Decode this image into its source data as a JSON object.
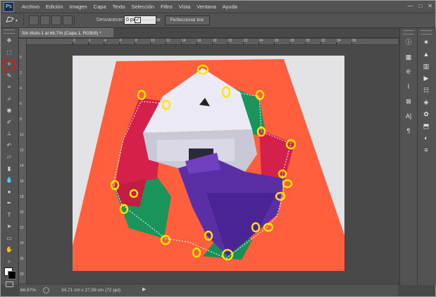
{
  "app": {
    "logo": "Ps"
  },
  "menu": [
    "Archivo",
    "Edición",
    "Imagen",
    "Capa",
    "Texto",
    "Selección",
    "Filtro",
    "Vista",
    "Ventana",
    "Ayuda"
  ],
  "window_controls": {
    "minimize": "—",
    "maximize": "□",
    "close": "✕"
  },
  "options": {
    "feather_label": "Desvanecer:",
    "feather_value": "0 px",
    "smooth_checked": "✓",
    "smooth_label": "Suavizar",
    "refine_label": "Perfeccionar bor."
  },
  "document": {
    "tab_title": "Sin título-1 al 66,7% (Capa 1, RGB/8) *"
  },
  "status": {
    "zoom": "66,67%",
    "doc_info": "34,71 cm x 27,59 cm (72 ppi)",
    "arrow": "▶"
  },
  "ruler_top_labels": [
    "0",
    "2",
    "4",
    "6",
    "8",
    "10",
    "12",
    "14",
    "16",
    "18",
    "20",
    "22",
    "24",
    "26",
    "28",
    "30",
    "32",
    "34",
    "36"
  ],
  "ruler_left_labels": [
    "0",
    "2",
    "4",
    "6",
    "8",
    "10",
    "12",
    "14",
    "16",
    "18",
    "20",
    "22",
    "24",
    "26",
    "28"
  ],
  "tools": [
    {
      "name": "move-tool",
      "glyph": "✥"
    },
    {
      "name": "marquee-tool",
      "glyph": "⬚"
    },
    {
      "name": "polygonal-lasso-tool",
      "glyph": "⟡"
    },
    {
      "name": "quick-selection-tool",
      "glyph": "✎"
    },
    {
      "name": "crop-tool",
      "glyph": "⌗"
    },
    {
      "name": "eyedropper-tool",
      "glyph": "⌿"
    },
    {
      "name": "spot-healing-tool",
      "glyph": "◉"
    },
    {
      "name": "brush-tool",
      "glyph": "✐"
    },
    {
      "name": "clone-stamp-tool",
      "glyph": "⊥"
    },
    {
      "name": "history-brush-tool",
      "glyph": "↶"
    },
    {
      "name": "eraser-tool",
      "glyph": "▱"
    },
    {
      "name": "gradient-tool",
      "glyph": "▮"
    },
    {
      "name": "blur-tool",
      "glyph": "💧"
    },
    {
      "name": "dodge-tool",
      "glyph": "●"
    },
    {
      "name": "pen-tool",
      "glyph": "✒"
    },
    {
      "name": "type-tool",
      "glyph": "T"
    },
    {
      "name": "path-selection-tool",
      "glyph": "➤"
    },
    {
      "name": "shape-tool",
      "glyph": "▭"
    },
    {
      "name": "hand-tool",
      "glyph": "✋"
    },
    {
      "name": "zoom-tool",
      "glyph": "⌕"
    }
  ],
  "right_panel_a": [
    {
      "name": "info-icon",
      "glyph": "ⓘ"
    },
    {
      "name": "navigator-icon",
      "glyph": "▦"
    },
    {
      "name": "adjust-icon",
      "glyph": "⚟"
    },
    {
      "name": "brush-preset-icon",
      "glyph": "⌇"
    },
    {
      "name": "clone-source-icon",
      "glyph": "⊠"
    },
    {
      "name": "character-icon",
      "glyph": "A|"
    },
    {
      "name": "paragraph-icon",
      "glyph": "¶"
    }
  ],
  "right_panel_b": [
    {
      "name": "color-icon",
      "glyph": "✷"
    },
    {
      "name": "histogram-icon",
      "glyph": "▲"
    },
    {
      "name": "swatches-icon",
      "glyph": "▥"
    },
    {
      "name": "actions-icon",
      "glyph": "▶"
    },
    {
      "name": "properties-icon",
      "glyph": "☷"
    },
    {
      "name": "layers-icon",
      "glyph": "◈"
    },
    {
      "name": "channels-icon",
      "glyph": "✿"
    },
    {
      "name": "paths-icon",
      "glyph": "⬒"
    },
    {
      "name": "styles-icon",
      "glyph": "◐"
    },
    {
      "name": "sliders-icon",
      "glyph": "≡"
    }
  ],
  "colors": {
    "background_paper": "#ff5f3c",
    "cube_white": "#ebeaf4",
    "cube_purple": "#5a2fa6",
    "panel_red": "#d4204a",
    "panel_green": "#19955c",
    "marker_yellow": "#ffe600",
    "highlight_red": "#e0141c"
  }
}
